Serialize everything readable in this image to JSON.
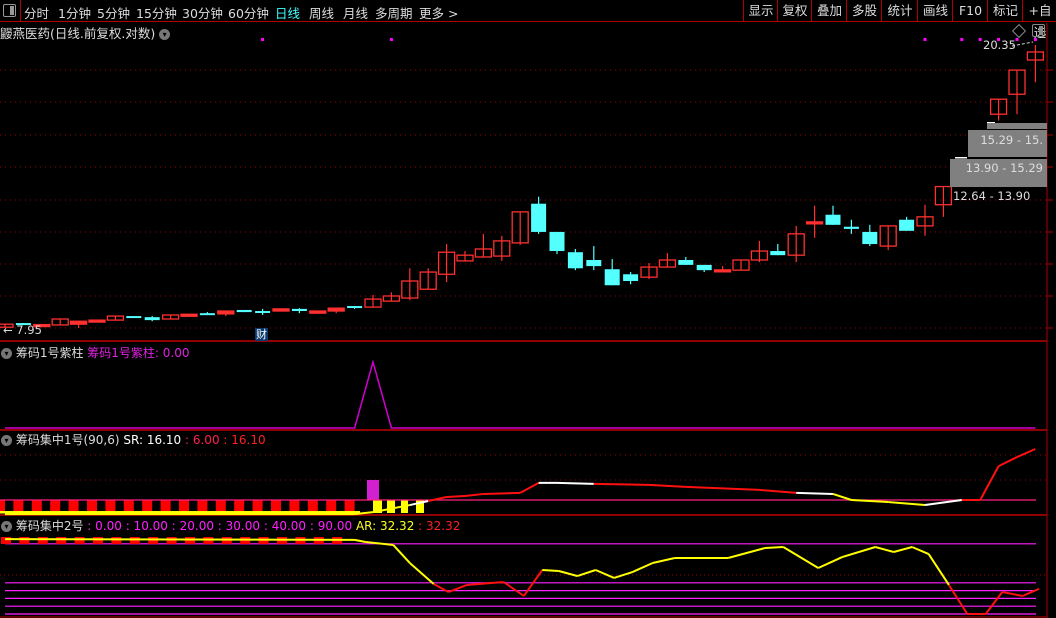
{
  "topbar": {
    "periods": [
      "分时",
      "1分钟",
      "5分钟",
      "15分钟",
      "30分钟",
      "60分钟",
      "日线",
      "周线",
      "月线",
      "多周期",
      "更多 >"
    ],
    "active_period": "日线",
    "buttons": [
      "显示",
      "复权",
      "叠加",
      "多股",
      "统计",
      "画线",
      "F10",
      "标记",
      "+自选"
    ]
  },
  "main": {
    "title": "鼹燕医药(日线.前复权.对数)",
    "scale": "log",
    "high_label": "20.35",
    "low_label": "← 7.95",
    "finance_badge": "财",
    "ranges": [
      "15.29 - 15.",
      "13.90 - 15.29",
      "12.64 - 13.90"
    ],
    "colors": {
      "up": "#ff3030",
      "down": "#54ffff",
      "grid": "#a00000",
      "marker": "#ff00ff"
    },
    "marker_candles": [
      14,
      21,
      50,
      52,
      53,
      54,
      55,
      56
    ],
    "candles": [
      [
        8.05,
        8.13,
        8.05,
        8.13
      ],
      [
        8.16,
        8.16,
        8.11,
        8.11
      ],
      [
        8.1,
        8.12,
        8.1,
        8.12
      ],
      [
        8.11,
        8.27,
        8.11,
        8.27
      ],
      [
        8.13,
        8.21,
        8.03,
        8.21
      ],
      [
        8.21,
        8.24,
        8.21,
        8.24
      ],
      [
        8.24,
        8.35,
        8.24,
        8.35
      ],
      [
        8.35,
        8.35,
        8.3,
        8.3
      ],
      [
        8.32,
        8.35,
        8.21,
        8.24
      ],
      [
        8.27,
        8.38,
        8.27,
        8.38
      ],
      [
        8.35,
        8.4,
        8.35,
        8.4
      ],
      [
        8.43,
        8.46,
        8.38,
        8.41
      ],
      [
        8.41,
        8.49,
        8.35,
        8.49
      ],
      [
        8.52,
        8.52,
        8.46,
        8.46
      ],
      [
        8.49,
        8.55,
        8.38,
        8.46
      ],
      [
        8.49,
        8.55,
        8.49,
        8.55
      ],
      [
        8.55,
        8.57,
        8.43,
        8.49
      ],
      [
        8.43,
        8.49,
        8.43,
        8.49
      ],
      [
        8.49,
        8.57,
        8.43,
        8.57
      ],
      [
        8.63,
        8.63,
        8.55,
        8.6
      ],
      [
        8.6,
        8.95,
        8.6,
        8.83
      ],
      [
        8.77,
        9.03,
        8.77,
        8.92
      ],
      [
        8.86,
        9.77,
        8.8,
        9.37
      ],
      [
        9.12,
        9.77,
        9.12,
        9.65
      ],
      [
        9.58,
        10.58,
        9.34,
        10.3
      ],
      [
        10.01,
        10.34,
        10.01,
        10.2
      ],
      [
        10.14,
        10.94,
        10.14,
        10.41
      ],
      [
        10.17,
        10.87,
        10.01,
        10.69
      ],
      [
        10.62,
        11.76,
        10.55,
        11.76
      ],
      [
        12.08,
        12.36,
        10.94,
        11.01
      ],
      [
        11.01,
        11.01,
        10.24,
        10.34
      ],
      [
        10.3,
        10.41,
        9.71,
        9.77
      ],
      [
        10.04,
        10.51,
        9.71,
        9.84
      ],
      [
        9.74,
        10.07,
        9.24,
        9.24
      ],
      [
        9.58,
        9.65,
        9.27,
        9.37
      ],
      [
        9.49,
        9.94,
        9.43,
        9.81
      ],
      [
        9.81,
        10.27,
        9.81,
        10.04
      ],
      [
        10.04,
        10.14,
        9.88,
        9.88
      ],
      [
        9.88,
        9.88,
        9.65,
        9.71
      ],
      [
        9.7,
        9.84,
        9.7,
        9.72
      ],
      [
        9.71,
        10.04,
        9.71,
        10.04
      ],
      [
        10.04,
        10.69,
        9.97,
        10.34
      ],
      [
        10.34,
        10.58,
        10.2,
        10.2
      ],
      [
        10.2,
        11.23,
        9.97,
        10.94
      ],
      [
        11.35,
        12.0,
        10.8,
        11.38
      ],
      [
        11.65,
        12.0,
        11.27,
        11.27
      ],
      [
        11.2,
        11.46,
        10.94,
        11.12
      ],
      [
        11.01,
        11.27,
        10.51,
        10.58
      ],
      [
        10.51,
        11.23,
        10.37,
        11.23
      ],
      [
        11.46,
        11.57,
        11.05,
        11.05
      ],
      [
        11.23,
        12.04,
        10.87,
        11.57
      ],
      [
        12.04,
        12.78,
        11.57,
        12.78
      ],
      null,
      null,
      [
        16.21,
        17.03,
        15.88,
        17.03
      ],
      [
        17.31,
        18.74,
        16.21,
        18.74
      ],
      [
        19.37,
        20.35,
        18.01,
        19.89
      ]
    ]
  },
  "panel1": {
    "name": "筹码1号紫柱",
    "series_label": "筹码1号紫柱: 0.00",
    "nonzero": {
      "20": 1
    },
    "color": "#d000d0"
  },
  "panel2": {
    "name": "筹码集中1号(90,6)",
    "sr_label": "SR: 16.10",
    "v1_label": ": 6.00",
    "v2_label": ": 16.10",
    "threshold": 6,
    "line": [
      [
        0,
        3.2,
        "#ffff00"
      ],
      [
        19,
        3.2,
        "#ffff00"
      ],
      [
        20,
        3.6,
        "#ffff00"
      ],
      [
        21,
        4.3,
        "#ffff00"
      ],
      [
        22,
        5.0,
        "#ffff00"
      ],
      [
        23,
        5.8,
        "#ffffff"
      ],
      [
        24,
        6.6,
        "#ff1010"
      ],
      [
        25,
        6.8,
        "#ff1010"
      ],
      [
        26,
        7.2,
        "#ff1010"
      ],
      [
        28,
        7.4,
        "#ff1010"
      ],
      [
        29,
        9.4,
        "#ff1010"
      ],
      [
        30,
        9.4,
        "#ffffff"
      ],
      [
        32,
        9.2,
        "#ffffff"
      ],
      [
        35,
        9.0,
        "#ff1010"
      ],
      [
        37,
        8.6,
        "#ff1010"
      ],
      [
        41,
        8.0,
        "#ff1010"
      ],
      [
        43,
        7.4,
        "#ff1010"
      ],
      [
        45,
        7.2,
        "#ffffff"
      ],
      [
        46,
        6.0,
        "#ffff00"
      ],
      [
        48,
        5.6,
        "#ffff00"
      ],
      [
        50,
        5.0,
        "#ffff00"
      ],
      [
        52,
        6.0,
        "#ffffff"
      ],
      [
        53,
        6.0,
        "#ff1010"
      ],
      [
        54,
        12.7,
        "#ff1010"
      ],
      [
        55,
        14.5,
        "#ff1010"
      ],
      [
        56,
        16.1,
        "#ff1010"
      ]
    ]
  },
  "panel3": {
    "name": "筹码集中2号",
    "levels": [
      {
        "label": ": 0.00",
        "value": 0
      },
      {
        "label": ": 10.00",
        "value": 10
      },
      {
        "label": ": 20.00",
        "value": 20
      },
      {
        "label": ": 30.00",
        "value": 30
      },
      {
        "label": ": 40.00",
        "value": 40
      },
      {
        "label": ": 90.00",
        "value": 90
      }
    ],
    "ar_label": "AR: 32.32",
    "ar_value_label": ": 32.32",
    "ar": [
      [
        0,
        96
      ],
      [
        19,
        95
      ],
      [
        19.6,
        92.3
      ],
      [
        21.1,
        88.5
      ],
      [
        22,
        65.4
      ],
      [
        23.3,
        38.5
      ],
      [
        24.1,
        28.2
      ],
      [
        25.1,
        37.2
      ],
      [
        27.1,
        41
      ],
      [
        28.2,
        23.1
      ],
      [
        29.2,
        56.4
      ],
      [
        30.1,
        55.1
      ],
      [
        31.1,
        48.7
      ],
      [
        32.1,
        56.4
      ],
      [
        33.1,
        46.2
      ],
      [
        34.1,
        53.8
      ],
      [
        35.2,
        65.4
      ],
      [
        36.4,
        71.8
      ],
      [
        39.3,
        71.8
      ],
      [
        41.3,
        84.6
      ],
      [
        42.3,
        85.9
      ],
      [
        44.2,
        59
      ],
      [
        45.5,
        73
      ],
      [
        47.3,
        85.9
      ],
      [
        48.3,
        79.5
      ],
      [
        49.3,
        85.9
      ],
      [
        50.2,
        76.9
      ],
      [
        51.3,
        37.2
      ],
      [
        52.3,
        0
      ],
      [
        53.3,
        0
      ],
      [
        54.2,
        28.2
      ],
      [
        55.3,
        23.1
      ],
      [
        56.2,
        32.32
      ]
    ]
  }
}
